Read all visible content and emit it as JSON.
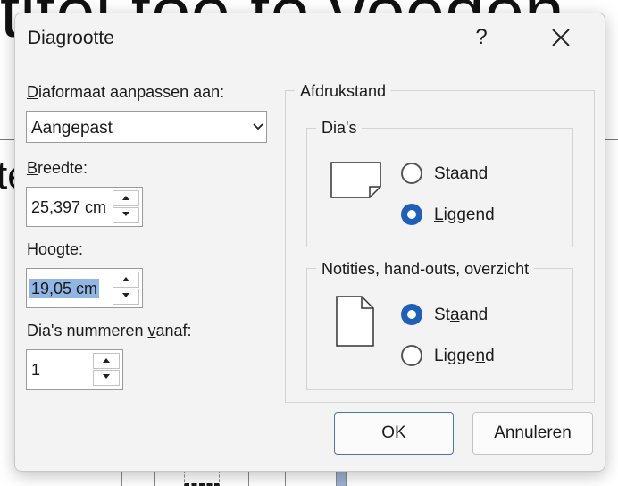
{
  "background": {
    "title_fragment": "titel toe te voegen",
    "text_fragment": "te"
  },
  "dialog": {
    "title": "Diagrootte",
    "help_label": "?",
    "size_for": {
      "label_mnemonic": "D",
      "label_rest": "iaformaat aanpassen aan:",
      "value": "Aangepast"
    },
    "width": {
      "label_mnemonic": "B",
      "label_rest": "reedte:",
      "value": "25,397 cm"
    },
    "height": {
      "label_mnemonic": "H",
      "label_rest": "oogte:",
      "value": "19,05 cm",
      "selected": true
    },
    "number_from": {
      "label_pre": "Dia's nummeren ",
      "label_mnemonic": "v",
      "label_rest": "anaf:",
      "value": "1"
    },
    "orientation": {
      "group_label": "Afdrukstand",
      "slides": {
        "label": "Dia's",
        "portrait": {
          "pre": "",
          "mnemonic": "S",
          "rest": "taand",
          "checked": false
        },
        "landscape": {
          "pre": "",
          "mnemonic": "L",
          "rest": "iggend",
          "checked": true
        }
      },
      "notes": {
        "label": "Notities, hand-outs, overzicht",
        "portrait": {
          "pre": "St",
          "mnemonic": "a",
          "rest": "and",
          "checked": true
        },
        "landscape": {
          "pre": "Ligge",
          "mnemonic": "n",
          "rest": "d",
          "checked": false
        }
      }
    },
    "ok_label": "OK",
    "cancel_label": "Annuleren"
  }
}
